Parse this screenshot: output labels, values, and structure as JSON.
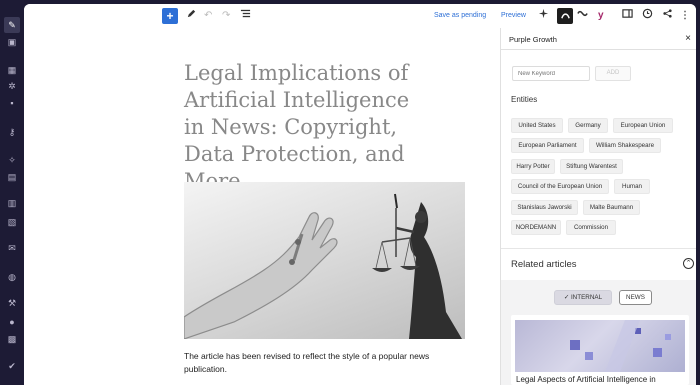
{
  "toolbar": {
    "add_block": "+",
    "save_pending": "Save as pending",
    "preview": "Preview"
  },
  "post": {
    "title": "Legal Implications of Artificial Intelligence in News: Copyright, Data Protection, and More",
    "caption": "The article has been revised to reflect the style of a popular news publication."
  },
  "sidebar": {
    "title": "Purple Growth",
    "close": "×",
    "keyword_placeholder": "New Keyword",
    "add_label": "ADD",
    "entities_heading": "Entities",
    "entities": [
      "United States",
      "Germany",
      "European Union",
      "European Parliament",
      "William Shakespeare",
      "Harry Potter",
      "Stiftung Warentest",
      "Council of the European Union",
      "Human",
      "Stanislaus Jaworski",
      "Malte Baumann",
      "NORDEMANN",
      "Commission"
    ],
    "related_heading": "Related articles",
    "tab_internal": "INTERNAL",
    "tab_news": "NEWS",
    "related_title": "Legal Aspects of Artificial Intelligence in"
  },
  "colors": {
    "accent": "#2d6fd6",
    "admin_bar": "#1d1b35"
  }
}
